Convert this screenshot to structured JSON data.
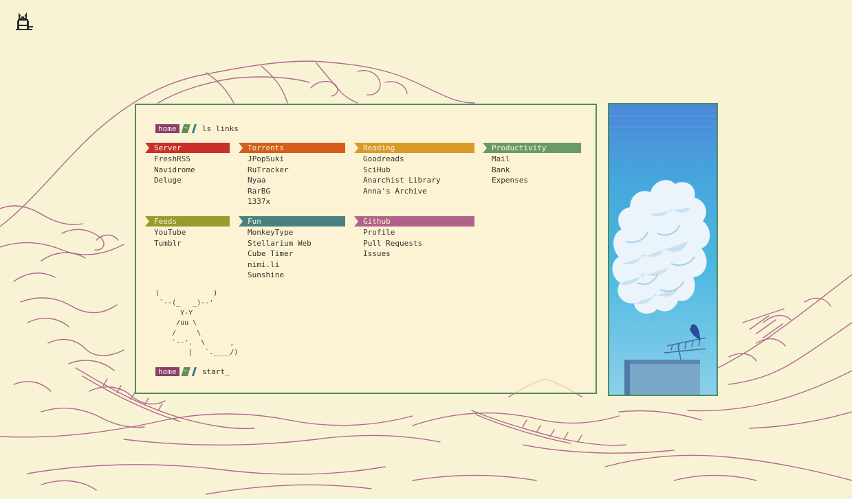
{
  "colors": {
    "background": "#f9f3d6",
    "wave_lines": "#b06a8e",
    "border": "#4f8a66",
    "server": "#c9302a",
    "torrents": "#d35e1a",
    "reading": "#d99a2a",
    "productivity": "#6b9a6a",
    "feeds": "#9a9a2a",
    "fun": "#4a8080",
    "github": "#b0628a"
  },
  "prompt": {
    "home": "home",
    "tilde": "~",
    "command": "ls links",
    "next_command": "start_"
  },
  "categories": [
    {
      "title": "Server",
      "color": "#c9302a",
      "links": [
        "FreshRSS",
        "Navidrome",
        "Deluge"
      ]
    },
    {
      "title": "Torrents",
      "color": "#d35e1a",
      "links": [
        "JPopSuki",
        "RuTracker",
        "Nyaa",
        "RarBG",
        "1337x"
      ]
    },
    {
      "title": "Reading",
      "color": "#d99a2a",
      "links": [
        "Goodreads",
        "SciHub",
        "Anarchist Library",
        "Anna's Archive"
      ]
    },
    {
      "title": "Productivity",
      "color": "#6b9a6a",
      "links": [
        "Mail",
        "Bank",
        "Expenses"
      ]
    },
    {
      "title": "Feeds",
      "color": "#9a9a2a",
      "links": [
        "YouTube",
        "Tumblr"
      ]
    },
    {
      "title": "Fun",
      "color": "#4a8080",
      "links": [
        "MonkeyType",
        "Stellarium Web",
        "Cube Timer",
        "nimi.li",
        "Sunshine"
      ]
    },
    {
      "title": "Github",
      "color": "#b0628a",
      "links": [
        "Profile",
        "Pull Requests",
        "Issues"
      ]
    }
  ],
  "ascii_art": "(             )\n `--(_   _)--'\n      Y-Y\n     /uu \\\n    /     \\\n    `--'.  \\      ,\n        |   `.____/)"
}
